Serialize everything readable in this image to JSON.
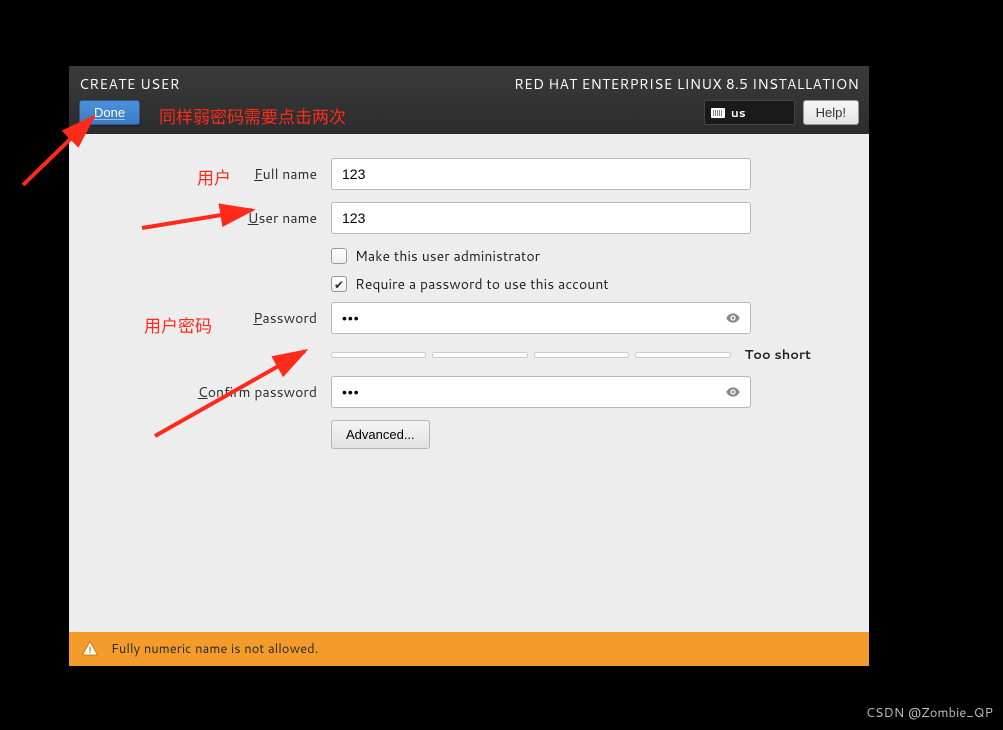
{
  "header": {
    "title": "CREATE USER",
    "done_label": "Done",
    "install_title": "RED HAT ENTERPRISE LINUX 8.5 INSTALLATION",
    "lang": "us",
    "help_label": "Help!"
  },
  "form": {
    "fullname_label_prefix": "F",
    "fullname_label_rest": "ull name",
    "fullname_value": "123",
    "username_label_prefix": "U",
    "username_label_rest": "ser name",
    "username_value": "123",
    "admin_checkbox_prefix": "M",
    "admin_checkbox_rest": "ake this user administrator",
    "admin_checked": false,
    "require_pwd_prefix": "R",
    "require_pwd_rest": "equire a password to use this account",
    "require_pwd_checked": true,
    "password_label_prefix": "P",
    "password_label_rest": "assword",
    "password_value": "•••",
    "confirm_label_prefix": "C",
    "confirm_label_rest": "onfirm password",
    "confirm_value": "•••",
    "strength_text": "Too short",
    "advanced_label": "Advanced..."
  },
  "warning": {
    "text": "Fully numeric name is not allowed."
  },
  "annotations": {
    "top_note": "同样弱密码需要点击两次",
    "user_label": "用户",
    "user_pwd_label": "用户密码"
  },
  "watermark": "CSDN @Zombie_QP"
}
